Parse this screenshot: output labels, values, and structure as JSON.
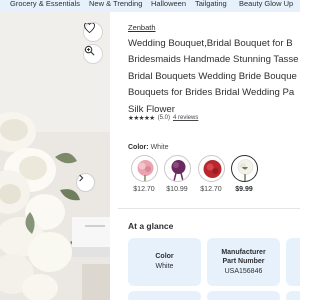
{
  "nav": {
    "items": [
      "Grocery & Essentials",
      "New & Trending",
      "Halloween",
      "Tailgating",
      "Beauty Glow Up"
    ]
  },
  "product": {
    "brand": "Zenbath",
    "title_lines": [
      "Wedding Bouquet,Bridal Bouquet for B",
      "Bridesmaids Handmade Stunning Tasse",
      "Bridal Bouquets Wedding Bride Bouque",
      "Bouquets for Brides Bridal Wedding Pa",
      "Silk Flower"
    ],
    "rating": {
      "stars": "★★★★★",
      "score_text": "(5.0)",
      "reviews_text": "4 reviews",
      "value": 5.0
    }
  },
  "color_picker": {
    "label": "Color:",
    "selected_value": "White",
    "options": [
      {
        "name": "pink",
        "price": "$12.70",
        "selected": false,
        "color": "#e9a3b1"
      },
      {
        "name": "purple",
        "price": "$10.99",
        "selected": false,
        "color": "#6b2a5e"
      },
      {
        "name": "red",
        "price": "$12.70",
        "selected": false,
        "color": "#b8272e"
      },
      {
        "name": "white",
        "price": "$9.99",
        "selected": true,
        "color": "#f4f2ea"
      }
    ]
  },
  "glance": {
    "title": "At a glance",
    "cards": [
      {
        "key": "Color",
        "value": "White"
      },
      {
        "key_lines": [
          "Manufacturer",
          "Part Number"
        ],
        "value": "USA156846"
      }
    ]
  },
  "icons": [
    "heart-icon",
    "zoom-in-icon",
    "chevron-right-icon"
  ],
  "colors": {
    "nav_bg": "#e6f1fc",
    "card_bg": "#e6f1fc",
    "text": "#2e2f32"
  }
}
